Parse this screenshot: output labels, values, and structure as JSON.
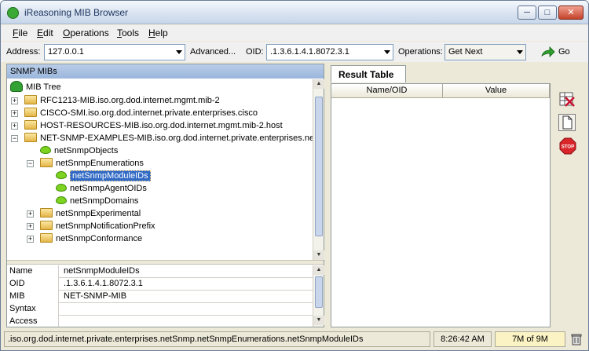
{
  "window": {
    "title": "iReasoning MIB Browser"
  },
  "menu": [
    {
      "key": "F",
      "rest": "ile"
    },
    {
      "key": "E",
      "rest": "dit"
    },
    {
      "key": "O",
      "rest": "perations"
    },
    {
      "key": "T",
      "rest": "ools"
    },
    {
      "key": "H",
      "rest": "elp"
    }
  ],
  "toolbar": {
    "address_label": "Address:",
    "address_value": "127.0.0.1",
    "advanced_label": "Advanced...",
    "oid_label": "OID:",
    "oid_value": ".1.3.6.1.4.1.8072.3.1",
    "operations_label": "Operations:",
    "operation_value": "Get Next",
    "go_label": "Go"
  },
  "left_panel": {
    "header": "SNMP MIBs",
    "tree": {
      "root": "MIB Tree",
      "nodes": [
        "RFC1213-MIB.iso.org.dod.internet.mgmt.mib-2",
        "CISCO-SMI.iso.org.dod.internet.private.enterprises.cisco",
        "HOST-RESOURCES-MIB.iso.org.dod.internet.mgmt.mib-2.host",
        "NET-SNMP-EXAMPLES-MIB.iso.org.dod.internet.private.enterprises.netSn",
        "netSnmpObjects",
        "netSnmpEnumerations",
        "netSnmpModuleIDs",
        "netSnmpAgentOIDs",
        "netSnmpDomains",
        "netSnmpExperimental",
        "netSnmpNotificationPrefix",
        "netSnmpConformance"
      ]
    },
    "properties": [
      {
        "name": "Name",
        "value": "netSnmpModuleIDs"
      },
      {
        "name": "OID",
        "value": ".1.3.6.1.4.1.8072.3.1"
      },
      {
        "name": "MIB",
        "value": "NET-SNMP-MIB"
      },
      {
        "name": "Syntax",
        "value": ""
      },
      {
        "name": "Access",
        "value": ""
      }
    ]
  },
  "right_panel": {
    "tab": "Result Table",
    "columns": [
      "Name/OID",
      "Value"
    ]
  },
  "status": {
    "path": ".iso.org.dod.internet.private.enterprises.netSnmp.netSnmpEnumerations.netSnmpModuleIDs",
    "time": "8:26:42 AM",
    "memory": "7M of 9M"
  }
}
